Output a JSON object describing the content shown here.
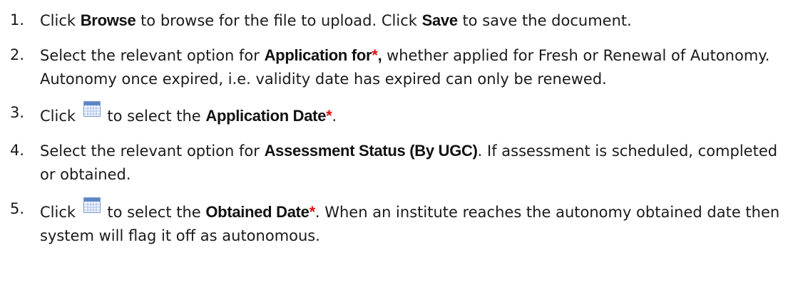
{
  "steps": [
    {
      "number": "1.",
      "t1": "Click ",
      "b1": "Browse",
      "t2": " to browse for the file to upload. Click ",
      "b2": "Save",
      "t3": " to save the document."
    },
    {
      "number": "2.",
      "t1": "Select the relevant option for ",
      "b1": "Application for",
      "req": "*",
      "b1_tail": ",",
      "t2": " whether applied for Fresh or Renewal of Autonomy. Autonomy once expired, i.e. validity date has expired can only be renewed."
    },
    {
      "number": "3.",
      "t1": "Click ",
      "icon": "calendar-icon",
      "t2": " to select the ",
      "b1": "Application Date",
      "req": "*",
      "t3": "."
    },
    {
      "number": "4.",
      "t1": "Select the relevant option for ",
      "b1": "Assessment Status (By UGC)",
      "t2": ". If assessment is scheduled, completed or obtained."
    },
    {
      "number": "5.",
      "t1": "Click ",
      "icon": "calendar-icon",
      "t2": " to select the ",
      "b1": "Obtained Date",
      "req": "*",
      "t3": ". When an institute reaches the autonomy obtained date then system will flag it off as autonomous."
    }
  ],
  "colors": {
    "required_asterisk": "#e01010",
    "calendar_icon_header": "#5b86c7",
    "calendar_icon_grid": "#a9c2e6"
  }
}
